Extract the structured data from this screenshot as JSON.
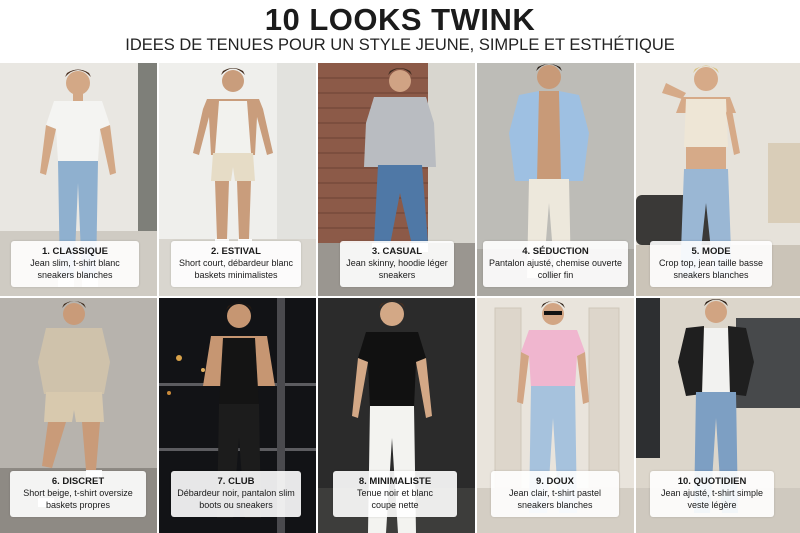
{
  "header": {
    "title": "10 LOOKS TWINK",
    "subtitle": "IDEES DE TENUES POUR UN STYLE JEUNE, SIMPLE ET ESTHÉTIQUE"
  },
  "looks": [
    {
      "title": "1. CLASSIQUE",
      "line1": "Jean slim, t-shirt blanc",
      "line2": "sneakers blanches",
      "background": "light wall",
      "top_color": "#f4f4f2",
      "bottom_color": "#8fb0cf"
    },
    {
      "title": "2. ESTIVAL",
      "line1": "Short court, débardeur blanc",
      "line2": "baskets minimalistes",
      "background": "white wall",
      "top_color": "#f2f2ee",
      "bottom_color": "#e6dcc6"
    },
    {
      "title": "3. CASUAL",
      "line1": "Jean skinny, hoodie léger",
      "line2": "sneakers",
      "background": "brick wall",
      "top_color": "#b9bcc1",
      "bottom_color": "#4f78a6"
    },
    {
      "title": "4. SÉDUCTION",
      "line1": "Pantalon ajusté, chemise ouverte",
      "line2": "collier fin",
      "background": "grey wall",
      "top_color": "#9ec0e2",
      "bottom_color": "#ede8dc"
    },
    {
      "title": "5. MODE",
      "line1": "Crop top, jean taille basse",
      "line2": "sneakers blanches",
      "background": "living room",
      "top_color": "#eee6d6",
      "bottom_color": "#9ab7d4"
    },
    {
      "title": "6. DISCRET",
      "line1": "Short beige, t-shirt oversize",
      "line2": "baskets propres",
      "background": "concrete",
      "top_color": "#cfc2ab",
      "bottom_color": "#d8c9ae"
    },
    {
      "title": "7. CLUB",
      "line1": "Débardeur noir, pantalon slim",
      "line2": "boots ou sneakers",
      "background": "night city",
      "top_color": "#141414",
      "bottom_color": "#1c1c1c"
    },
    {
      "title": "8. MINIMALISTE",
      "line1": "Tenue noir et blanc",
      "line2": "coupe nette",
      "background": "dark wall",
      "top_color": "#111111",
      "bottom_color": "#f3f3f0"
    },
    {
      "title": "9. DOUX",
      "line1": "Jean clair, t-shirt pastel",
      "line2": "sneakers blanches",
      "background": "white door",
      "top_color": "#f0b6cf",
      "bottom_color": "#a6c2dd"
    },
    {
      "title": "10. QUOTIDIEN",
      "line1": "Jean ajusté, t-shirt simple",
      "line2": "veste légère",
      "background": "storefront",
      "top_color": "#1f1f1f",
      "bottom_color": "#7d9fc3"
    }
  ]
}
